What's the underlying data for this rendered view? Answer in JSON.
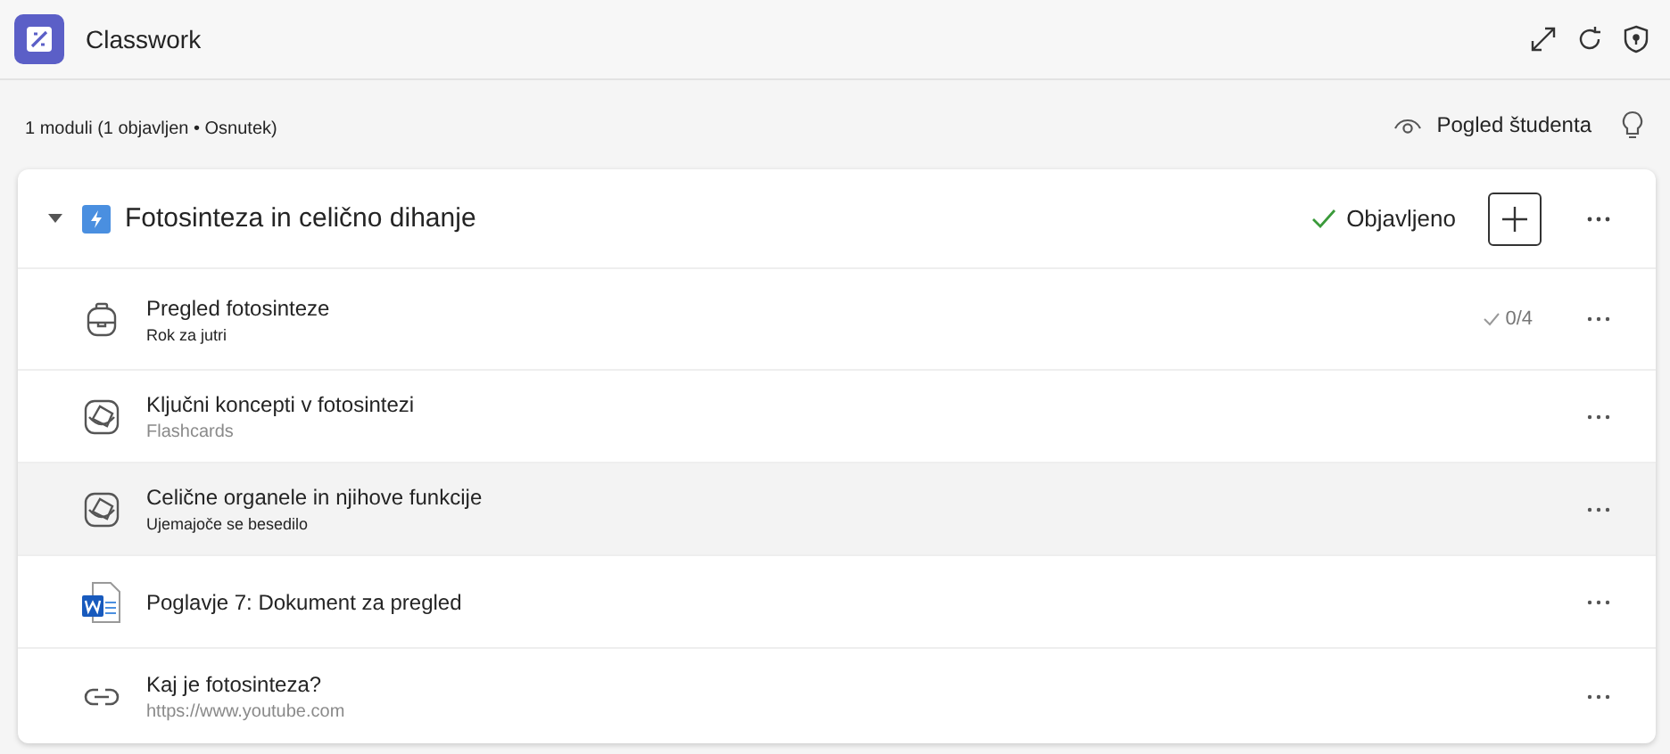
{
  "app": {
    "title": "Classwork"
  },
  "summary": "1 moduli (1 objavljen • Osnutek)",
  "student_view": {
    "label": "Pogled študenta"
  },
  "module": {
    "title": "Fotosinteza in celično dihanje",
    "expanded": true,
    "status": "Objavljeno",
    "items": [
      {
        "kind": "assignment",
        "title": "Pregled fotosinteze",
        "subtitle": "Rok za jutri",
        "progress": "0/4",
        "highlighted": false
      },
      {
        "kind": "flashcards",
        "title": "Ključni koncepti v fotosintezi",
        "subtitle": "Flashcards",
        "highlighted": false
      },
      {
        "kind": "matching",
        "title": "Celične organele in njihove funkcije",
        "subtitle": "Ujemajoče se besedilo",
        "highlighted": true
      },
      {
        "kind": "document",
        "title": "Poglavje 7: Dokument za pregled",
        "highlighted": false
      },
      {
        "kind": "link",
        "title": "Kaj je fotosinteza?",
        "subtitle": "https://www.youtube.com",
        "highlighted": false
      }
    ]
  }
}
